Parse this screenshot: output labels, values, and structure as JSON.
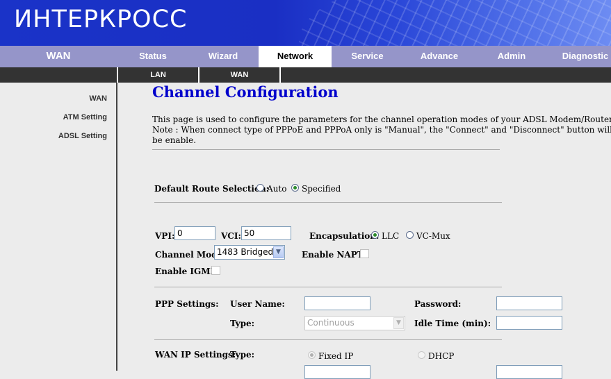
{
  "banner": {
    "logo_text": "ИНТЕРКРОСС"
  },
  "nav": {
    "section_title": "WAN",
    "tabs": [
      "Status",
      "Wizard",
      "Network",
      "Service",
      "Advance",
      "Admin",
      "Diagnostic"
    ],
    "active_tab": "Network",
    "subtabs": [
      "LAN",
      "WAN"
    ]
  },
  "sidebar": {
    "items": [
      "WAN",
      "ATM Setting",
      "ADSL Setting"
    ]
  },
  "main": {
    "title": "Channel Configuration",
    "description_line1": "This page is used to configure the parameters for the channel operation modes of your ADSL Modem/Router.",
    "description_line2": "Note : When connect type of PPPoE and PPPoA only is \"Manual\", the \"Connect\" and \"Disconnect\" button will",
    "description_line3": "be enable.",
    "default_route": {
      "label": "Default Route Selection:",
      "options": [
        "Auto",
        "Specified"
      ],
      "selected": "Specified"
    },
    "vpi": {
      "label": "VPI:",
      "value": "0"
    },
    "vci": {
      "label": "VCI:",
      "value": "50"
    },
    "encapsulation": {
      "label": "Encapsulation:",
      "options": [
        "LLC",
        "VC-Mux"
      ],
      "selected": "LLC"
    },
    "channel_mode": {
      "label": "Channel Mode:",
      "value": "1483 Bridged"
    },
    "enable_napt": {
      "label": "Enable NAPT:",
      "checked": false
    },
    "enable_igmp": {
      "label": "Enable IGMP:",
      "checked": false
    },
    "ppp": {
      "section_label": "PPP Settings:",
      "user_name_label": "User Name:",
      "password_label": "Password:",
      "type_label": "Type:",
      "type_value": "Continuous",
      "idle_time_label": "Idle Time (min):"
    },
    "wan_ip": {
      "section_label": "WAN IP Settings:",
      "type_label": "Type:",
      "options": [
        "Fixed IP",
        "DHCP"
      ],
      "selected": "Fixed IP"
    }
  },
  "colors": {
    "banner_blue": "#1a33c8",
    "nav_purple": "#9595c9",
    "subnav_dark": "#333333",
    "title_blue": "#0000cc"
  }
}
